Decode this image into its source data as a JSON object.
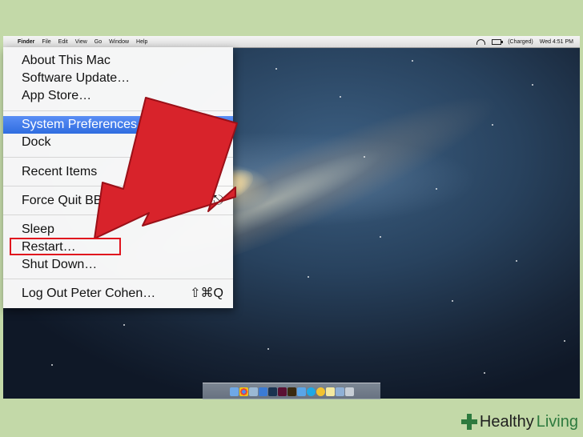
{
  "menubar": {
    "apple_glyph": "",
    "app": "Finder",
    "items": [
      "File",
      "Edit",
      "View",
      "Go",
      "Window",
      "Help"
    ],
    "battery_status": "(Charged)",
    "clock": "Wed 4:51 PM"
  },
  "apple_menu": {
    "items": [
      {
        "label": "About This Mac",
        "shortcut": ""
      },
      {
        "label": "Software Update…",
        "shortcut": ""
      },
      {
        "label": "App Store…",
        "shortcut": ""
      },
      {
        "label": "System Preferences…",
        "shortcut": "",
        "highlighted": true
      },
      {
        "label": "Dock",
        "shortcut": ""
      },
      {
        "label": "Recent Items",
        "shortcut": "",
        "submenu": true
      },
      {
        "label": "Force Quit BBEdit",
        "shortcut": "⌥⌘⎋"
      },
      {
        "label": "Sleep",
        "shortcut": ""
      },
      {
        "label": "Restart…",
        "shortcut": ""
      },
      {
        "label": "Shut Down…",
        "shortcut": ""
      },
      {
        "label": "Log Out Peter Cohen…",
        "shortcut": "⇧⌘Q"
      }
    ]
  },
  "annotation": {
    "arrow_color": "#e0262f",
    "highlight_target": "Restart…"
  },
  "dock": {
    "icons": [
      "finder-icon",
      "chrome-icon",
      "preview-icon",
      "safari-icon",
      "photoshop-icon",
      "indesign-icon",
      "illustrator-icon",
      "itunes-icon",
      "skype-icon",
      "messages-icon",
      "notes-icon",
      "folder-icon",
      "trash-icon"
    ]
  },
  "watermark": {
    "part1": "Healthy",
    "part2": "Living"
  }
}
